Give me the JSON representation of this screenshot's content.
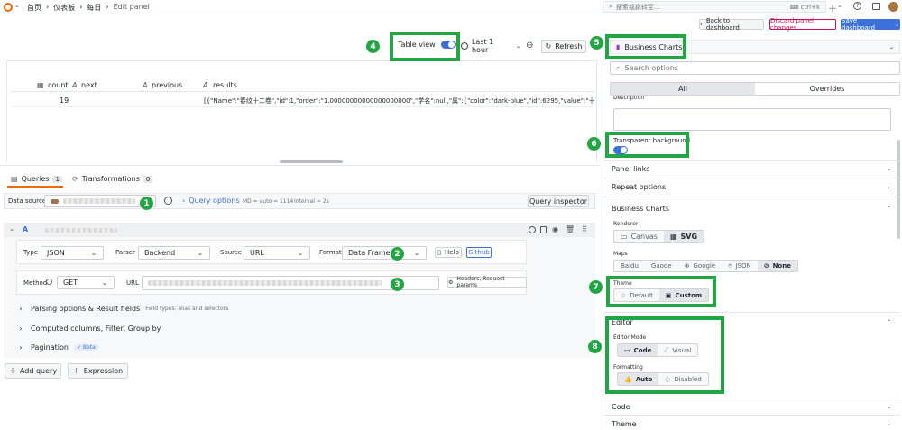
{
  "topbar": {
    "breadcrumb": [
      "首页",
      "仪表板",
      "每日",
      "Edit panel"
    ],
    "search_placeholder": "搜索或跳转至...",
    "shortcut": "ctrl+k"
  },
  "actions": {
    "back": "Back to dashboard",
    "discard": "Discard panel changes",
    "save": "Save dashboard"
  },
  "toolbar": {
    "table_view": "Table view",
    "time_range": "Last 1 hour",
    "refresh": "Refresh"
  },
  "table": {
    "columns": [
      "count",
      "next",
      "previous",
      "results"
    ],
    "row": {
      "count": "19",
      "results": "[{\"Name\":\"春纹十二卷\",\"id\":1,\"order\":\"1.00000000000000000000\",\"学名\":null,\"属\":{\"color\":\"dark-blue\",\"id\":6295,\"value\":\"十二卷属"
    }
  },
  "query_tabs": {
    "queries": "Queries",
    "queries_count": "1",
    "transformations": "Transformations",
    "transformations_count": "0"
  },
  "datasource": {
    "label": "Data source",
    "query_options": "Query options",
    "md_info": "MD = auto = 1114",
    "interval_info": "Interval = 2s",
    "inspector": "Query inspector"
  },
  "query": {
    "ref": "A",
    "type_label": "Type",
    "type_value": "JSON",
    "parser_label": "Parser",
    "parser_value": "Backend",
    "source_label": "Source",
    "source_value": "URL",
    "format_label": "Format",
    "format_value": "Data Frame",
    "help": "Help",
    "github": "Github",
    "method_label": "Method",
    "method_value": "GET",
    "url_label": "URL",
    "headers": "Headers, Request params",
    "parsing": "Parsing options & Result fields",
    "parsing_hint": "Field types, alias and selectors",
    "computed": "Computed columns, Filter, Group by",
    "pagination": "Pagination",
    "beta": "Beta",
    "add_query": "Add query",
    "expression": "Expression"
  },
  "panel": {
    "viz": "Business Charts",
    "search_placeholder": "Search options",
    "tab_all": "All",
    "tab_overrides": "Overrides",
    "description": "Description",
    "transparent_bg": "Transparent background",
    "panel_links": "Panel links",
    "repeat_options": "Repeat options",
    "bc_section": "Business Charts",
    "renderer_label": "Renderer",
    "renderer": [
      "Canvas",
      "SVG"
    ],
    "maps_label": "Maps",
    "maps": [
      "Baidu",
      "Gaode",
      "Google",
      "JSON",
      "None"
    ],
    "theme_label": "Theme",
    "theme": [
      "Default",
      "Custom"
    ],
    "editor_section": "Editor",
    "editor_mode_label": "Editor Mode",
    "editor_mode": [
      "Code",
      "Visual"
    ],
    "formatting_label": "Formatting",
    "formatting": [
      "Auto",
      "Disabled"
    ],
    "code_section": "Code",
    "theme_section": "Theme"
  },
  "annotations": [
    "1",
    "2",
    "3",
    "4",
    "5",
    "6",
    "7",
    "8"
  ],
  "colors": {
    "accent": "#3d71d9",
    "annotation": "#22a543",
    "danger": "#d10e5c"
  }
}
